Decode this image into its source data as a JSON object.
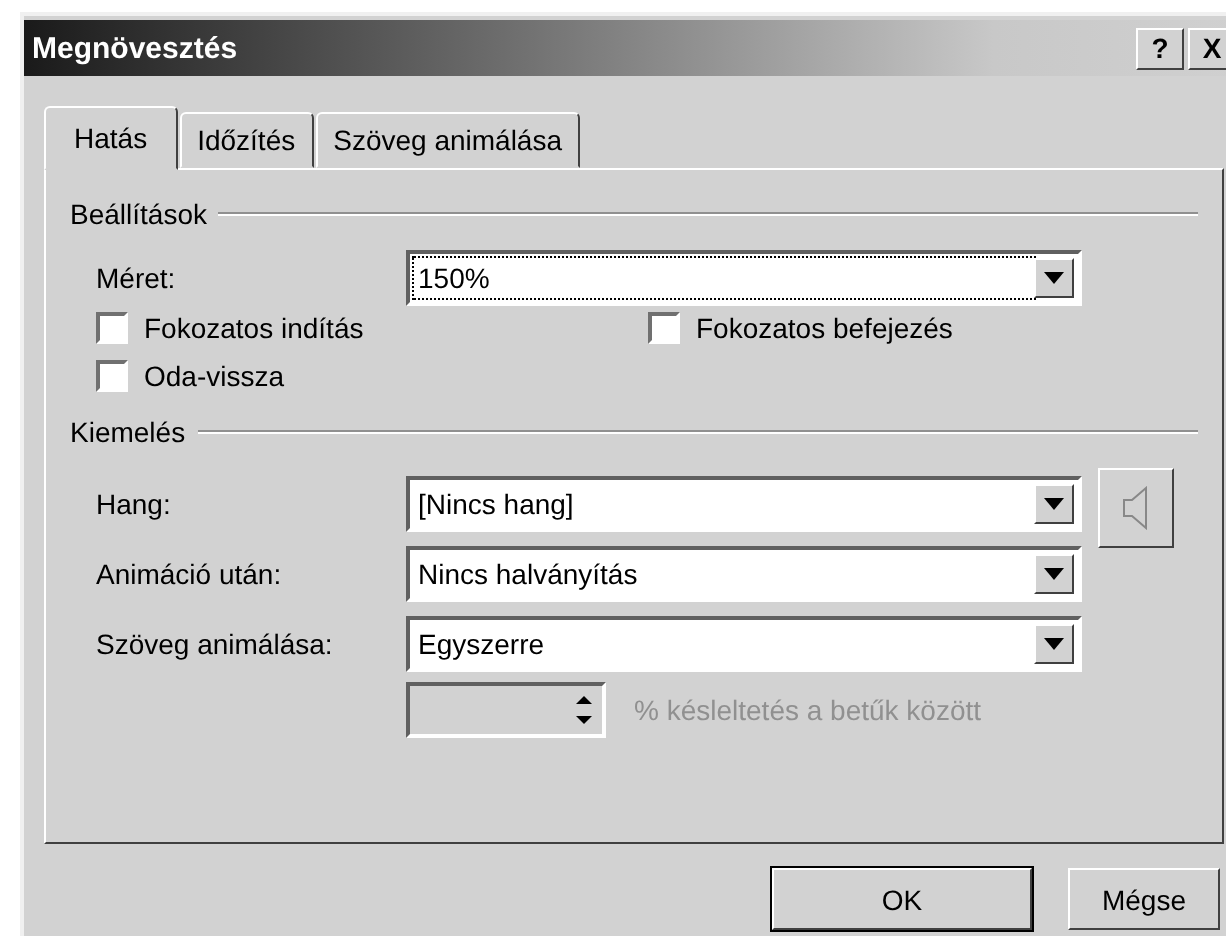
{
  "window": {
    "title": "Megnövesztés",
    "help_button": "?",
    "close_button": "X"
  },
  "tabs": [
    {
      "label": "Hatás",
      "selected": true
    },
    {
      "label": "Időzítés",
      "selected": false
    },
    {
      "label": "Szöveg animálása",
      "selected": false
    }
  ],
  "settings": {
    "title": "Beállítások",
    "size": {
      "label": "Méret:",
      "value": "150%",
      "focused": true
    },
    "checkboxes": [
      {
        "label": "Fokozatos indítás",
        "checked": false
      },
      {
        "label": "Fokozatos befejezés",
        "checked": false
      },
      {
        "label": "Oda-vissza",
        "checked": false
      }
    ]
  },
  "enhancements": {
    "title": "Kiemelés",
    "rows": [
      {
        "label": "Hang:",
        "value": "[Nincs hang]"
      },
      {
        "label": "Animáció után:",
        "value": "Nincs halványítás"
      },
      {
        "label": "Szöveg animálása:",
        "value": "Egyszerre"
      }
    ],
    "sound_button": {
      "disabled": true
    },
    "delay": {
      "disabled": true,
      "label": "% késleltetés a betűk között"
    }
  },
  "buttons": [
    {
      "label": "OK",
      "default": true
    },
    {
      "label": "Mégse",
      "default": false
    }
  ]
}
